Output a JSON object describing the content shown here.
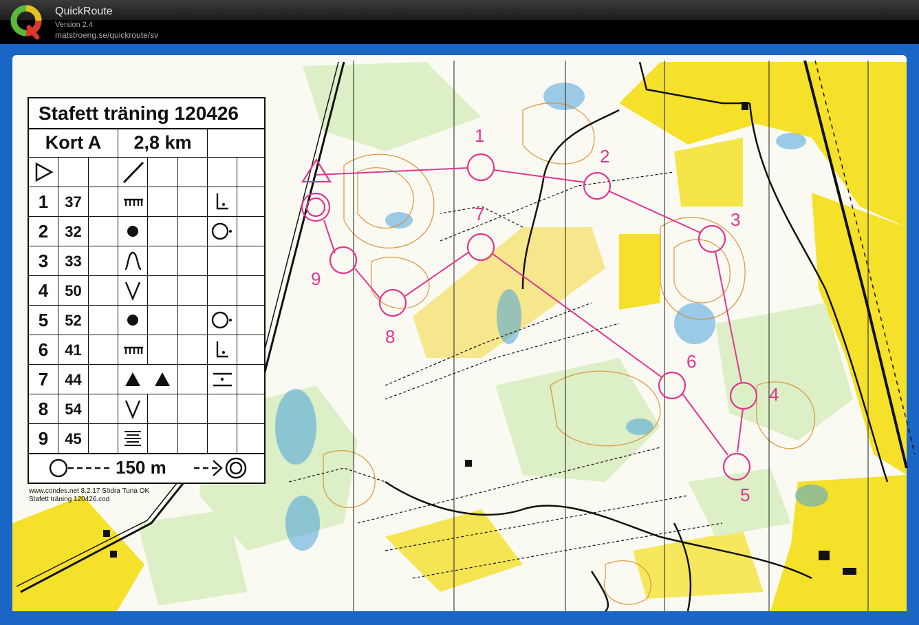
{
  "app": {
    "name": "QuickRoute",
    "version": "Version 2.4",
    "url": "matstroeng.se/quickroute/sv"
  },
  "legend": {
    "title": "Stafett träning 120426",
    "course": "Kort A",
    "length": "2,8 km",
    "controls": [
      {
        "n": "1",
        "code": "37"
      },
      {
        "n": "2",
        "code": "32"
      },
      {
        "n": "3",
        "code": "33"
      },
      {
        "n": "4",
        "code": "50"
      },
      {
        "n": "5",
        "code": "52"
      },
      {
        "n": "6",
        "code": "41"
      },
      {
        "n": "7",
        "code": "44"
      },
      {
        "n": "8",
        "code": "54"
      },
      {
        "n": "9",
        "code": "45"
      }
    ],
    "finish_distance": "150 m"
  },
  "credit": {
    "line1": "www.condes.net 8.2.17 Södra Tuna OK",
    "line2": "Stafett träning 120426.cod"
  },
  "map": {
    "control_labels": [
      "1",
      "2",
      "3",
      "4",
      "5",
      "6",
      "7",
      "8",
      "9"
    ],
    "colors": {
      "frame": "#1a66c4",
      "paper": "#fbfaf2",
      "open_land": "#f5e02a",
      "forest_light": "#dcefc6",
      "marsh": "#4aa3dd",
      "contour": "#d9892a",
      "course": "#e0358f",
      "track": "#111111"
    }
  }
}
